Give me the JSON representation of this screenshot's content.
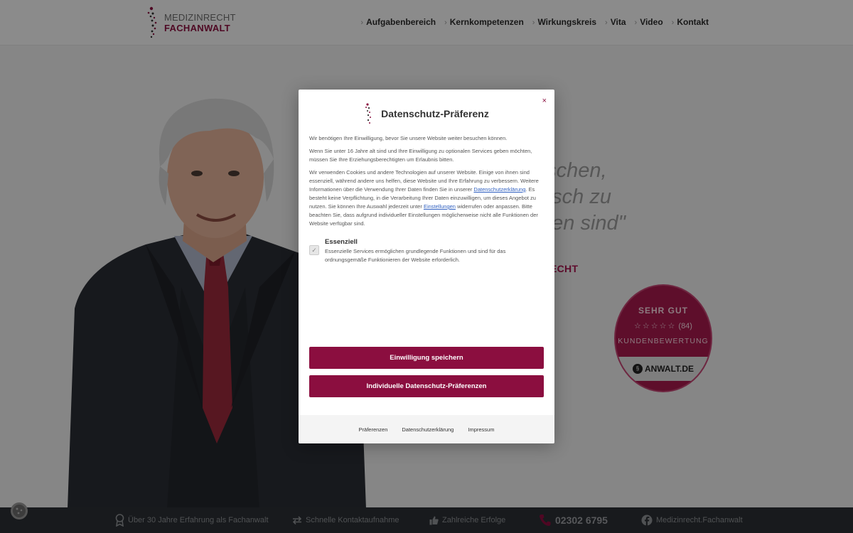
{
  "header": {
    "logo_line1": "MEDIZINRECHT",
    "logo_line2": "FACHANWALT",
    "nav": [
      "Aufgabenbereich",
      "Kernkompetenzen",
      "Wirkungskreis",
      "Vita",
      "Video",
      "Kontakt"
    ]
  },
  "hero": {
    "quote_lines": [
      "nschen,",
      "fusch zu",
      "men sind\""
    ],
    "subtitle": "ECHT",
    "badge": {
      "title": "SEHR GUT",
      "stars": "☆☆☆☆☆",
      "count": "(84)",
      "label": "KUNDENBEWERTUNG",
      "brand": "ANWALT.DE"
    }
  },
  "footer": {
    "items": [
      {
        "icon": "award-icon",
        "text": "Über 30 Jahre Erfahrung als Fachanwalt"
      },
      {
        "icon": "arrows-exchange-icon",
        "text": "Schnelle Kontaktaufnahme"
      },
      {
        "icon": "thumbs-up-icon",
        "text": "Zahlreiche Erfolge"
      },
      {
        "icon": "phone-icon",
        "text": "02302 6795"
      },
      {
        "icon": "facebook-icon",
        "text": "Medizinrecht.Fachanwalt"
      }
    ]
  },
  "modal": {
    "close": "×",
    "title": "Datenschutz-Präferenz",
    "p1": "Wir benötigen Ihre Einwilligung, bevor Sie unsere Website weiter besuchen können.",
    "p2": "Wenn Sie unter 16 Jahre alt sind und Ihre Einwilligung zu optionalen Services geben möchten, müssen Sie Ihre Erziehungsberechtigten um Erlaubnis bitten.",
    "p3_a": "Wir verwenden Cookies und andere Technologien auf unserer Website. Einige von ihnen sind essenziell, während andere uns helfen, diese Website und Ihre Erfahrung zu verbessern. Weitere Informationen über die Verwendung Ihrer Daten finden Sie in unserer ",
    "p3_link1": "Datenschutzerklärung",
    "p3_b": ". Es besteht keine Verpflichtung, in die Verarbeitung Ihrer Daten einzuwilligen, um dieses Angebot zu nutzen. Sie können Ihre Auswahl jederzeit unter ",
    "p3_link2": "Einstellungen",
    "p3_c": " widerrufen oder anpassen. Bitte beachten Sie, dass aufgrund individueller Einstellungen möglicherweise nicht alle Funktionen der Website verfügbar sind.",
    "checkbox_mark": "✓",
    "essential_title": "Essenziell",
    "essential_desc": "Essenzielle Services ermöglichen grundlegende Funktionen und sind für das ordnungsgemäße Funktionieren der Website erforderlich.",
    "btn_save": "Einwilligung speichern",
    "btn_individual": "Individuelle Datenschutz-Präferenzen",
    "footer_links": [
      "Präferenzen",
      "Datenschutzerklärung",
      "Impressum"
    ]
  },
  "colors": {
    "brand": "#8b0e3f",
    "footer_bg": "#2b2f33"
  }
}
